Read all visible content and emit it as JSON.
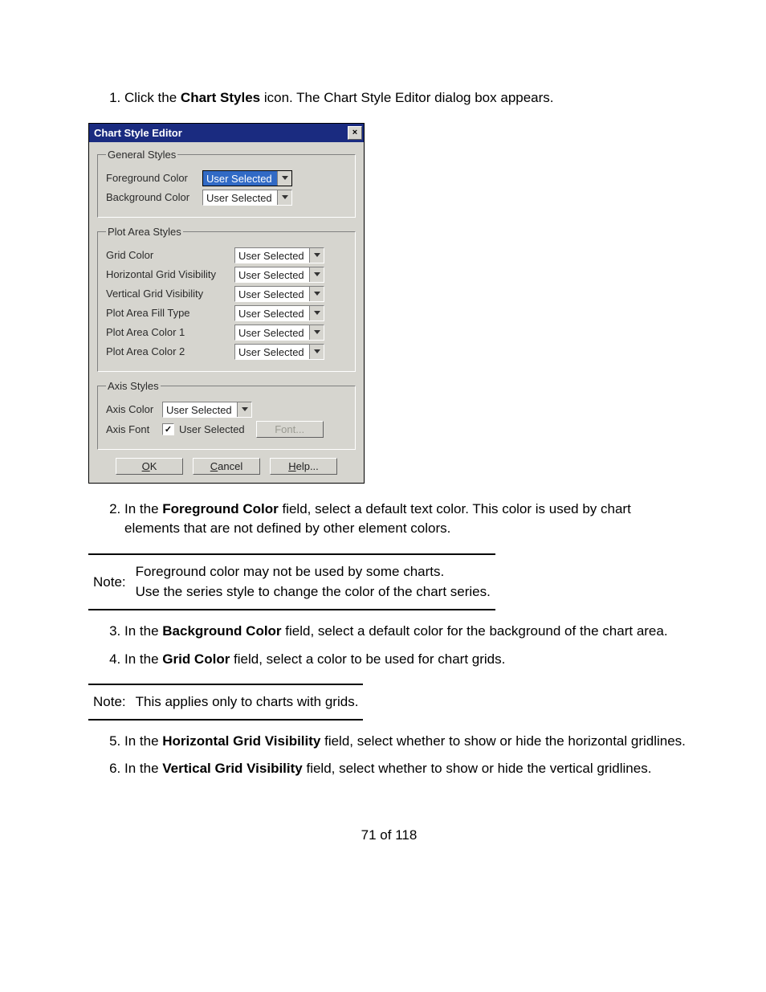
{
  "step1": {
    "pre": "Click the ",
    "bold": "Chart Styles",
    "post": " icon. The Chart Style Editor dialog box appears."
  },
  "dialog": {
    "title": "Chart Style Editor",
    "groups": {
      "general": {
        "legend": "General Styles",
        "fg_label": "Foreground Color",
        "fg_value": "User Selected",
        "bg_label": "Background Color",
        "bg_value": "User Selected"
      },
      "plot": {
        "legend": "Plot Area Styles",
        "grid_color_label": "Grid Color",
        "grid_color_value": "User Selected",
        "hgrid_label": "Horizontal Grid Visibility",
        "hgrid_value": "User Selected",
        "vgrid_label": "Vertical Grid Visibility",
        "vgrid_value": "User Selected",
        "fill_label": "Plot Area Fill Type",
        "fill_value": "User Selected",
        "color1_label": "Plot Area Color 1",
        "color1_value": "User Selected",
        "color2_label": "Plot Area Color 2",
        "color2_value": "User Selected"
      },
      "axis": {
        "legend": "Axis Styles",
        "axis_color_label": "Axis Color",
        "axis_color_value": "User Selected",
        "axis_font_label": "Axis Font",
        "axis_font_check_text": "User Selected",
        "font_button": "Font..."
      }
    },
    "buttons": {
      "ok_u": "O",
      "ok_rest": "K",
      "cancel_u": "C",
      "cancel_rest": "ancel",
      "help_u": "H",
      "help_rest": "elp..."
    }
  },
  "step2": {
    "pre": "In the ",
    "bold": "Foreground Color",
    "post": " field, select a default text color. This color is used by chart elements that are not defined by other element colors."
  },
  "note1": {
    "label": "Note:",
    "line1": "Foreground color may not be used by some charts.",
    "line2": "Use the series style to change the color of the chart series."
  },
  "step3": {
    "pre": "In the ",
    "bold": "Background Color",
    "post": " field, select a default color for the background of the chart area."
  },
  "step4": {
    "pre": "In the ",
    "bold": "Grid Color",
    "post": " field, select a color to be used for chart grids."
  },
  "note2": {
    "label": "Note:",
    "text": "This applies only to charts with grids."
  },
  "step5": {
    "pre": "In the ",
    "bold": "Horizontal Grid Visibility",
    "post": " field, select whether to show or hide the horizontal gridlines."
  },
  "step6": {
    "pre": "In the ",
    "bold": "Vertical Grid Visibility",
    "post": " field, select whether to show or hide the vertical gridlines."
  },
  "page_number": "71 of 118"
}
